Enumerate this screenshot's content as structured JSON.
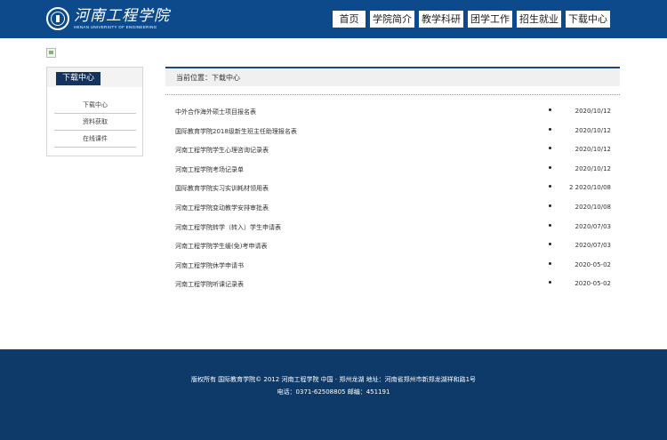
{
  "header": {
    "logo_cn": "河南工程学院",
    "logo_en": "HENAN UNIVERSITY OF ENGINEERING",
    "nav": [
      "首页",
      "学院简介",
      "教学科研",
      "团学工作",
      "招生就业",
      "下载中心"
    ]
  },
  "sidebar": {
    "title": "下载中心",
    "items": [
      "下载中心",
      "资料获取",
      "在线课件"
    ]
  },
  "main": {
    "breadcrumb": "当前位置：下载中心",
    "rows": [
      {
        "title": "中外合作海外硕士项目报名表",
        "date": "2020/10/12"
      },
      {
        "title": "国际教育学院2018级新生班主任助理报名表",
        "date": "2020/10/12"
      },
      {
        "title": "河南工程学院学生心理咨询记录表",
        "date": "2020/10/12"
      },
      {
        "title": "河南工程学院考场记录单",
        "date": "2020/10/12"
      },
      {
        "title": "国际教育学院实习实训耗材领用表",
        "date": "2 2020/10/08"
      },
      {
        "title": "河南工程学院变动教学安排审批表",
        "date": "2020/10/08"
      },
      {
        "title": "河南工程学院转学（转入）学生申请表",
        "date": "2020/07/03"
      },
      {
        "title": "河南工程学院学生缓(免)考申请表",
        "date": "2020/07/03"
      },
      {
        "title": "河南工程学院休学申请书",
        "date": "2020-05-02"
      },
      {
        "title": "河南工程学院听课记录表",
        "date": "2020-05-02"
      }
    ]
  },
  "footer": {
    "line1": "版权所有 国际教育学院© 2012 河南工程学院 中国 · 郑州龙湖  地址：河南省郑州市新郑龙湖祥和路1号",
    "line2": "电话：0371-62508805 邮编：451191"
  },
  "colors": {
    "header_bg": "#0d4a8b",
    "footer_bg": "#0e3a6a",
    "sidebar_title_bg": "#12335e"
  }
}
